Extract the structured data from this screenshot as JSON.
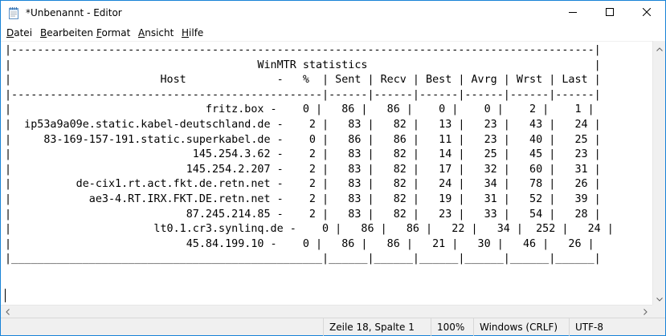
{
  "window": {
    "title": "*Unbenannt - Editor"
  },
  "menu": {
    "items": [
      {
        "accel": "D",
        "rest": "atei"
      },
      {
        "accel": "B",
        "rest": "earbeiten"
      },
      {
        "accel": "F",
        "rest": "ormat"
      },
      {
        "accel": "A",
        "rest": "nsicht"
      },
      {
        "accel": "H",
        "rest": "ilfe"
      }
    ]
  },
  "editor": {
    "lines": [
      "|------------------------------------------------------------------------------------------|",
      "|                                      WinMTR statistics                                   |",
      "|                       Host              -   %  | Sent | Recv | Best | Avrg | Wrst | Last |",
      "|------------------------------------------------|------|------|------|------|------|------|",
      "|                              fritz.box -    0 |   86 |   86 |    0 |    0 |    2 |    1 |",
      "|  ip53a9a09e.static.kabel-deutschland.de -    2 |   83 |   82 |   13 |   23 |   43 |   24 |",
      "|     83-169-157-191.static.superkabel.de -    0 |   86 |   86 |   11 |   23 |   40 |   25 |",
      "|                            145.254.3.62 -    2 |   83 |   82 |   14 |   25 |   45 |   23 |",
      "|                           145.254.2.207 -    2 |   83 |   82 |   17 |   32 |   60 |   31 |",
      "|          de-cix1.rt.act.fkt.de.retn.net -    2 |   83 |   82 |   24 |   34 |   78 |   26 |",
      "|            ae3-4.RT.IRX.FKT.DE.retn.net -    2 |   83 |   82 |   19 |   31 |   52 |   39 |",
      "|                           87.245.214.85 -    2 |   83 |   82 |   23 |   33 |   54 |   28 |",
      "|                      lt0.1.cr3.synlinq.de -    0 |   86 |   86 |   22 |   34 |  252 |   24 |",
      "|                           45.84.199.10 -    0 |   86 |   86 |   21 |   30 |   46 |   26 |",
      "|________________________________________________|______|______|______|______|______|______|",
      "",
      ""
    ]
  },
  "status": {
    "position": "Zeile 18, Spalte 1",
    "zoom": "100%",
    "line_ending": "Windows (CRLF)",
    "encoding": "UTF-8"
  },
  "icons": {
    "app": "notepad-icon",
    "minimize": "minimize-icon",
    "maximize": "maximize-icon",
    "close": "close-icon"
  }
}
